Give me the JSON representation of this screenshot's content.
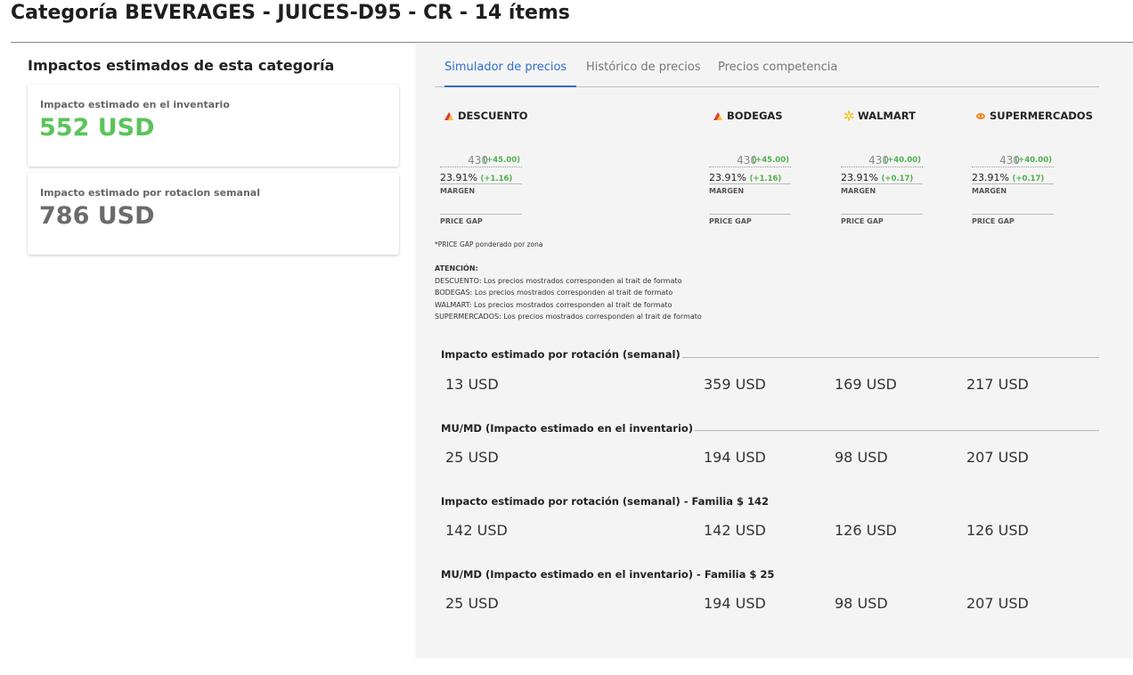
{
  "page": {
    "title": "Categoría BEVERAGES - JUICES-D95 - CR - 14 ítems"
  },
  "left": {
    "heading": "Impactos estimados de esta categoría",
    "cards": [
      {
        "label": "Impacto estimado en el inventario",
        "value": "552 USD",
        "color": "#5ac45a"
      },
      {
        "label": "Impacto estimado por rotacion semanal",
        "value": "786 USD",
        "color": "#6b6b6b"
      }
    ]
  },
  "tabs": [
    {
      "label": "Simulador de precios",
      "active": true
    },
    {
      "label": "Histórico de precios",
      "active": false
    },
    {
      "label": "Precios competencia",
      "active": false
    }
  ],
  "competitors": [
    {
      "name": "DESCUENTO",
      "icon": "descuento-logo-icon",
      "price": "430",
      "delta": "(+45.00)",
      "margin": "23.91%",
      "margin_delta": "(+1.16)"
    },
    {
      "name": "BODEGAS",
      "icon": "bodegas-logo-icon",
      "price": "430",
      "delta": "(+45.00)",
      "margin": "23.91%",
      "margin_delta": "(+1.16)"
    },
    {
      "name": "WALMART",
      "icon": "walmart-spark-icon",
      "price": "430",
      "delta": "(+40.00)",
      "margin": "23.91%",
      "margin_delta": "(+0.17)"
    },
    {
      "name": "SUPERMERCADOS",
      "icon": "supermercados-logo-icon",
      "price": "430",
      "delta": "(+40.00)",
      "margin": "23.91%",
      "margin_delta": "(+0.17)"
    }
  ],
  "labels": {
    "margin": "MARGEN",
    "price_gap": "PRICE GAP"
  },
  "footnote": "*PRICE GAP ponderado por zona",
  "attention": {
    "heading": "ATENCIÓN:",
    "lines": [
      "DESCUENTO: Los precios mostrados corresponden al trait de formato",
      "BODEGAS: Los precios mostrados corresponden al trait de formato",
      "WALMART: Los precios mostrados corresponden al trait de formato",
      "SUPERMERCADOS: Los precios mostrados corresponden al trait de formato"
    ]
  },
  "sections": [
    {
      "title": "Impacto estimado por rotación (semanal)",
      "values": [
        "13 USD",
        "359 USD",
        "169 USD",
        "217 USD"
      ]
    },
    {
      "title": "MU/MD (Impacto estimado en el inventario)",
      "values": [
        "25 USD",
        "194 USD",
        "98 USD",
        "207 USD"
      ]
    },
    {
      "title": "Impacto estimado por rotación (semanal) - Familia $ 142",
      "values": [
        "142 USD",
        "142 USD",
        "126 USD",
        "126 USD"
      ]
    },
    {
      "title": "MU/MD (Impacto estimado en el inventario) - Familia $ 25",
      "values": [
        "25 USD",
        "194 USD",
        "98 USD",
        "207 USD"
      ]
    }
  ],
  "colors": {
    "accent": "#2f6fd1",
    "positive": "#4fb24f",
    "panel": "#f4f4f4"
  }
}
